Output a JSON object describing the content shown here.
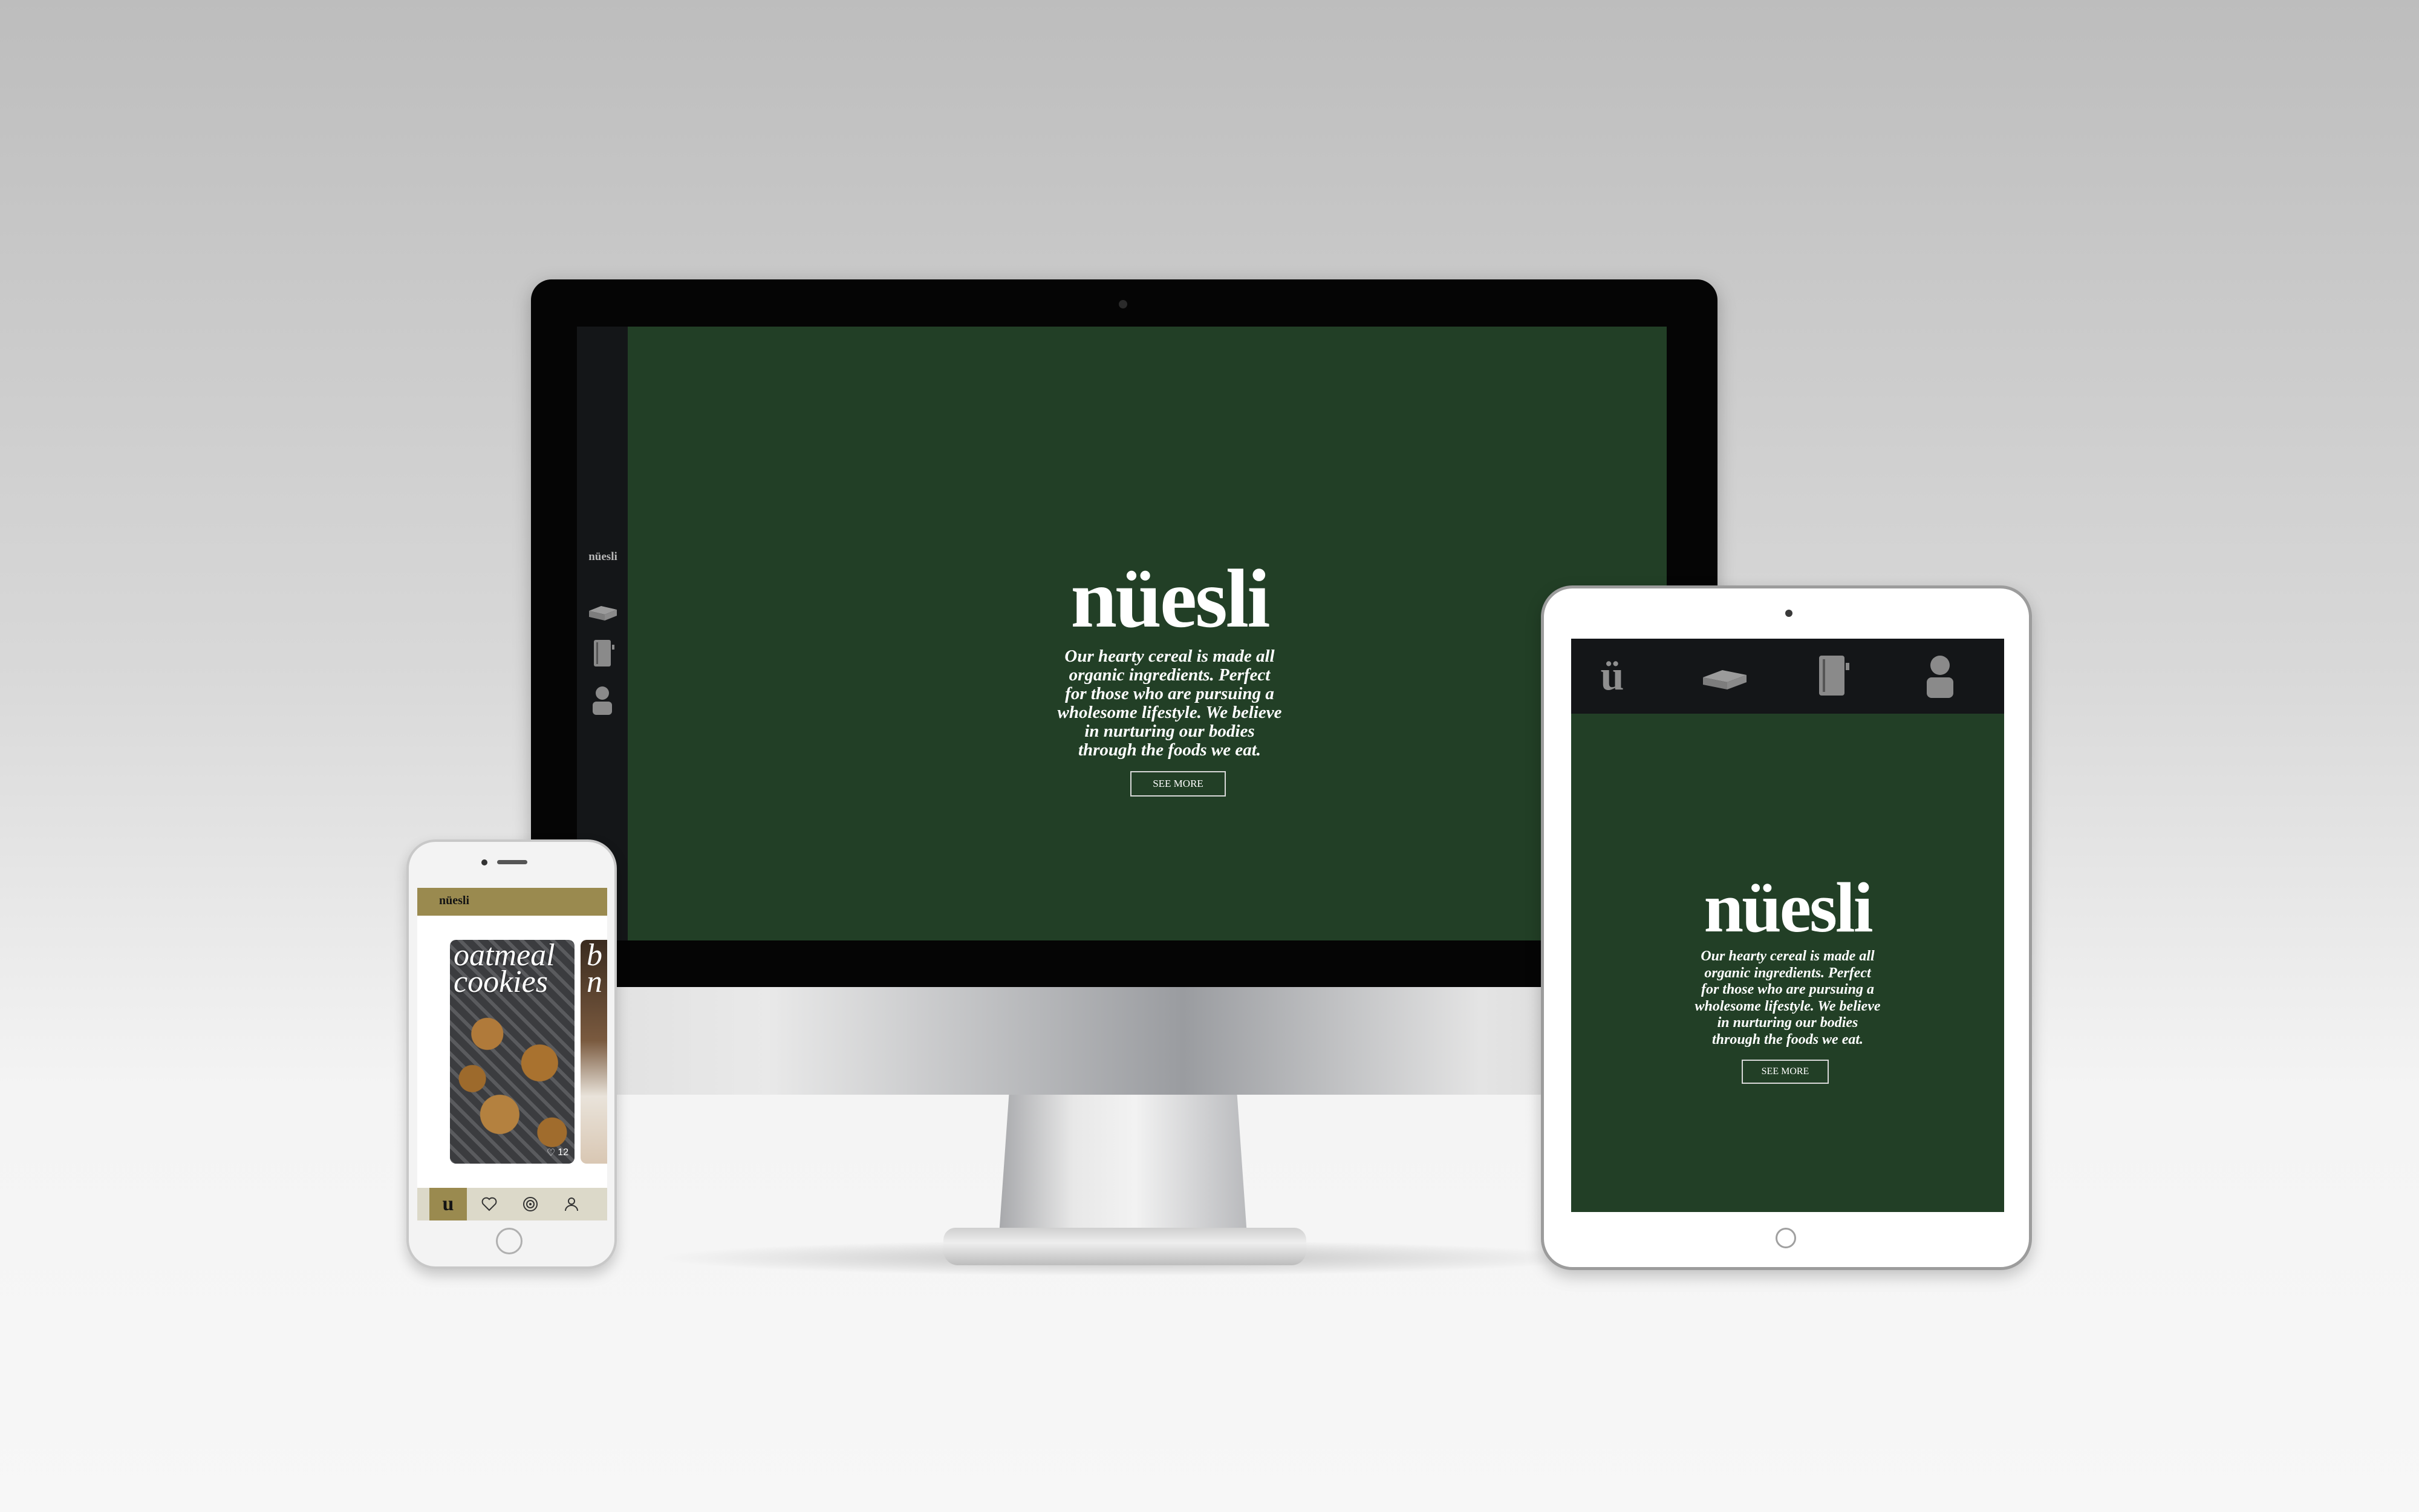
{
  "brand": {
    "logo_text": "nüesli",
    "tagline": "Our hearty cereal is made all\norganic ingredients. Perfect\nfor those who are pursuing a\nwholesome lifestyle. We believe\nin nurturing our bodies\nthrough the foods we eat.",
    "cta_label": "SEE MORE",
    "colors": {
      "primary_green": "#223f26",
      "nav_dark": "#141618",
      "gold": "#9a8a4f"
    }
  },
  "desktop": {
    "sidebar": {
      "logo_text": "nüesli",
      "icons": [
        "box-icon",
        "notebook-icon",
        "user-icon"
      ]
    }
  },
  "tablet": {
    "nav": {
      "icons": [
        "logo-u-icon",
        "box-icon",
        "notebook-icon",
        "user-icon"
      ]
    }
  },
  "phone": {
    "header_logo": "nüesli",
    "cards": [
      {
        "title": "oatmeal\ncookies",
        "likes": "12"
      },
      {
        "title": "b\nn",
        "likes": ""
      }
    ],
    "tabs": [
      "logo-u-icon",
      "heart-icon",
      "target-icon",
      "user-icon"
    ]
  }
}
